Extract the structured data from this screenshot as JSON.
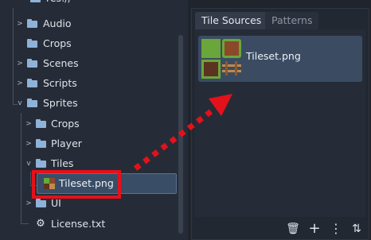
{
  "file_tree": {
    "root_label_partial": "res://",
    "items": [
      {
        "label": "Audio",
        "icon": "folder-icon"
      },
      {
        "label": "Crops",
        "icon": "folder-icon"
      },
      {
        "label": "Scenes",
        "icon": "folder-icon"
      },
      {
        "label": "Scripts",
        "icon": "folder-icon"
      },
      {
        "label": "Sprites",
        "icon": "folder-icon"
      },
      {
        "label": "Crops",
        "icon": "folder-icon"
      },
      {
        "label": "Player",
        "icon": "folder-icon"
      },
      {
        "label": "Tiles",
        "icon": "folder-icon"
      },
      {
        "label": "Tileset.png",
        "icon": "tileset-image-icon"
      },
      {
        "label": "UI",
        "icon": "folder-icon"
      },
      {
        "label": "License.txt",
        "icon": "license-file-icon"
      }
    ],
    "selected": "Tileset.png"
  },
  "tileset_panel": {
    "tabs": [
      {
        "label": "Tile Sources",
        "active": true
      },
      {
        "label": "Patterns",
        "active": false
      }
    ],
    "sources": [
      {
        "label": "Tileset.png"
      }
    ],
    "tools": [
      {
        "icon": "trash-icon",
        "glyph": "🗑"
      },
      {
        "icon": "add-icon",
        "glyph": "+"
      },
      {
        "icon": "more-options-icon",
        "glyph": "⋮"
      },
      {
        "icon": "sort-icon",
        "glyph": "⇅"
      }
    ]
  },
  "annotation": {
    "highlight_color": "#e4111b",
    "arrow_color": "#e4111b"
  },
  "colors": {
    "folder": "#8fb2d8",
    "selection": "#3a4d66",
    "panel_bg": "#262c37",
    "grass": "#6aa63a",
    "dirt": "#8a4a2a"
  }
}
